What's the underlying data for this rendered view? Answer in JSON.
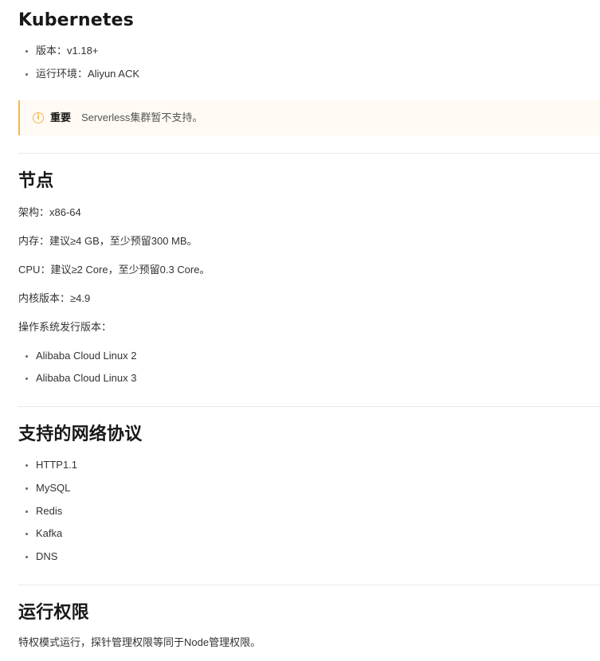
{
  "kubernetes": {
    "title": "Kubernetes",
    "items": [
      "版本：v1.18+",
      "运行环境：Aliyun ACK"
    ],
    "note": {
      "icon": "info-circle-icon",
      "label": "重要",
      "text": "Serverless集群暂不支持。",
      "accent": "#f3b84a"
    }
  },
  "node": {
    "title": "节点",
    "arch": "架构：x86-64",
    "memory": "内存：建议≥4 GB，至少预留300 MB。",
    "cpu": "CPU：建议≥2 Core，至少预留0.3 Core。",
    "kernel": "内核版本：≥4.9",
    "os_label": "操作系统发行版本：",
    "os_items": [
      "Alibaba Cloud Linux 2",
      "Alibaba Cloud Linux 3"
    ]
  },
  "network": {
    "title": "支持的网络协议",
    "items": [
      "HTTP1.1",
      "MySQL",
      "Redis",
      "Kafka",
      "DNS"
    ]
  },
  "permission": {
    "title": "运行权限",
    "text": "特权模式运行，探针管理权限等同于Node管理权限。"
  }
}
